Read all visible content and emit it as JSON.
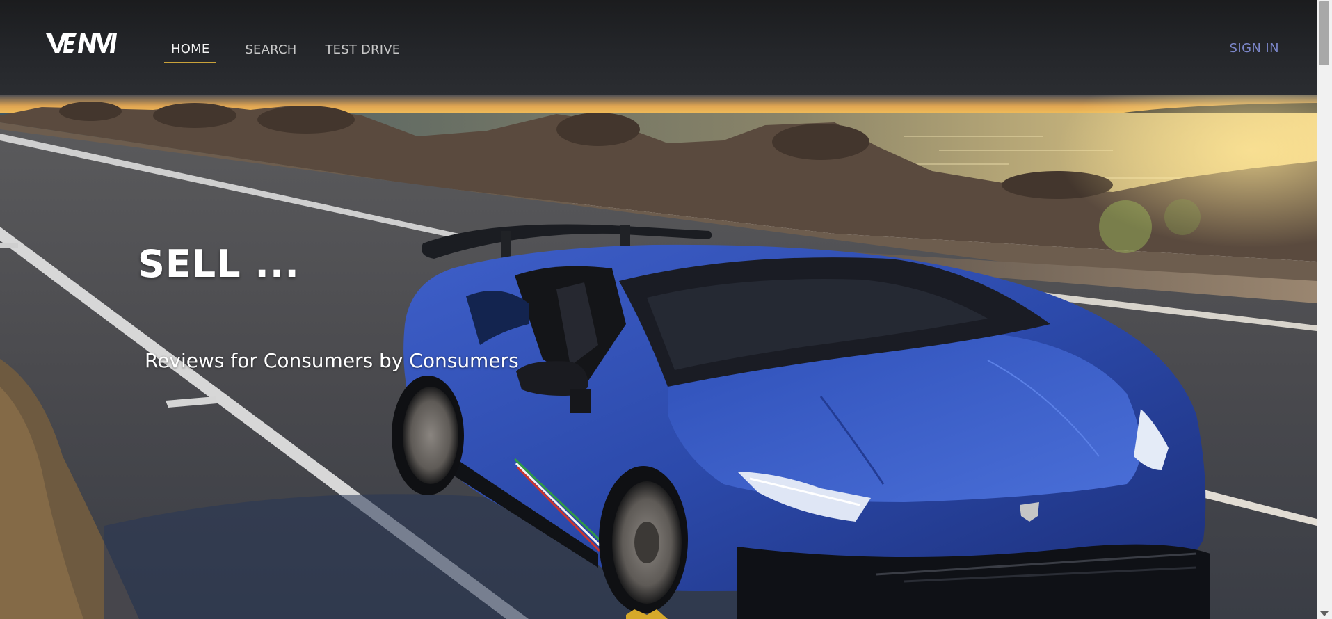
{
  "brand": {
    "logo_text": "VENVI",
    "accent_color": "#c9a23a",
    "signin_color": "#7b86c9"
  },
  "nav": {
    "items": [
      {
        "label": "HOME",
        "active": true
      },
      {
        "label": "SEARCH",
        "active": false
      },
      {
        "label": "TEST DRIVE",
        "active": false
      }
    ],
    "signin_label": "SIGN IN"
  },
  "hero": {
    "title": "SELL ...",
    "subtitle": "Reviews for Consumers by Consumers",
    "image": "blue-convertible-sports-car-coastal-road-sunset"
  }
}
